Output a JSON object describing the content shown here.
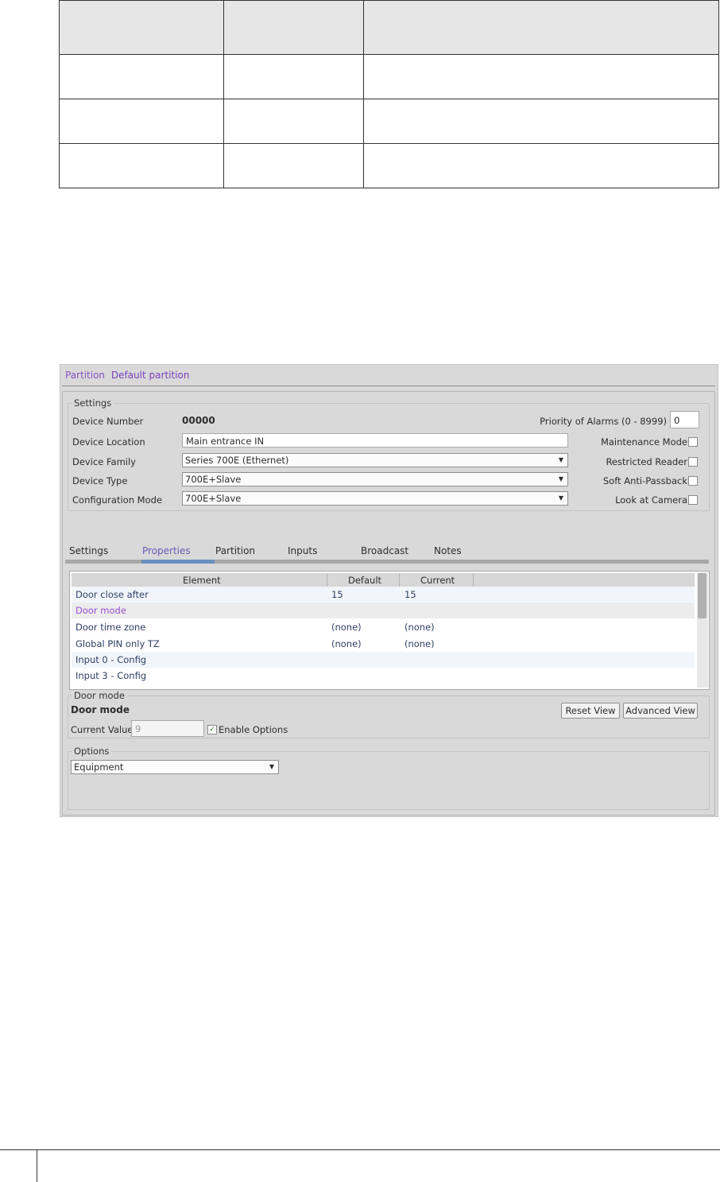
{
  "panel": {
    "title_label": "Partition",
    "title_value": "Default partition",
    "settings": {
      "legend": "Settings",
      "device_number_label": "Device Number",
      "device_number_value": "00000",
      "device_location_label": "Device Location",
      "device_location_value": "Main entrance IN",
      "device_family_label": "Device Family",
      "device_family_value": "Series 700E (Ethernet)",
      "device_type_label": "Device Type",
      "device_type_value": "700E+Slave",
      "configuration_mode_label": "Configuration Mode",
      "configuration_mode_value": "700E+Slave",
      "priority_label": "Priority of Alarms (0 - 8999)",
      "priority_value": "0",
      "maintenance_mode_label": "Maintenance Mode",
      "restricted_reader_label": "Restricted Reader",
      "soft_anti_passback_label": "Soft Anti-Passback",
      "look_at_camera_label": "Look at Camera"
    },
    "tabs": [
      {
        "label": "Settings"
      },
      {
        "label": "Properties"
      },
      {
        "label": "Partition"
      },
      {
        "label": "Inputs"
      },
      {
        "label": "Broadcast"
      },
      {
        "label": "Notes"
      }
    ],
    "active_tab": "Properties",
    "grid": {
      "columns": [
        "Element",
        "Default",
        "Current"
      ],
      "rows": [
        {
          "element": "Door close after",
          "default": "15",
          "current": "15"
        },
        {
          "element": "Door mode",
          "default": "",
          "current": ""
        },
        {
          "element": "Door time zone",
          "default": "(none)",
          "current": "(none)"
        },
        {
          "element": "Global PIN only TZ",
          "default": "(none)",
          "current": "(none)"
        },
        {
          "element": "Input 0 - Config",
          "default": "",
          "current": ""
        },
        {
          "element": "Input 3 - Config",
          "default": "",
          "current": ""
        }
      ],
      "selected_row": "Door mode"
    },
    "door_mode": {
      "legend": "Door mode",
      "title": "Door mode",
      "current_value_label": "Current Value",
      "current_value": "9",
      "enable_options_label": "Enable Options",
      "enable_options_checked": true,
      "reset_view_label": "Reset View",
      "advanced_view_label": "Advanced View"
    },
    "options": {
      "legend": "Options",
      "select_value": "Equipment"
    }
  }
}
